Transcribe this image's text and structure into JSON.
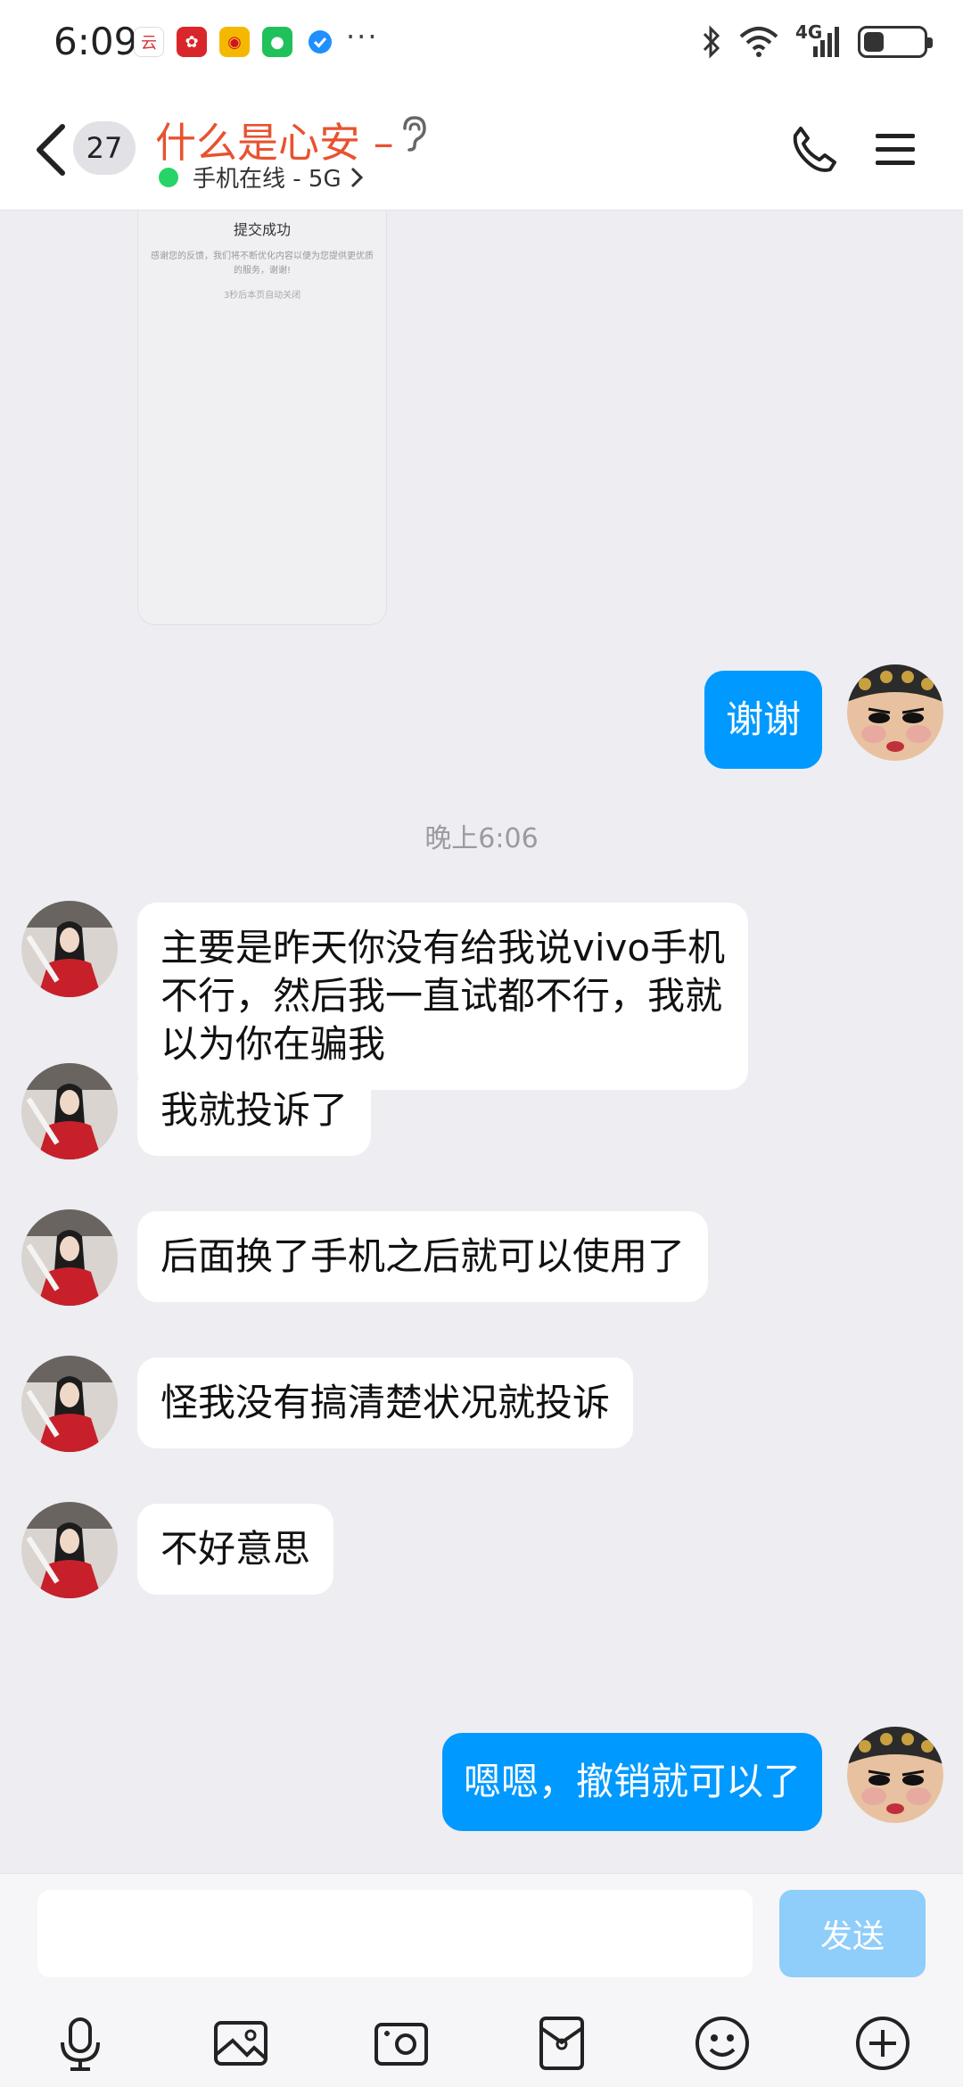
{
  "status_bar": {
    "time": "6:09",
    "more": "···",
    "network": "4G"
  },
  "header": {
    "unread_count": "27",
    "title": "什么是心安 –",
    "online_status": "手机在线 - 5G"
  },
  "messages": {
    "screenshot_card": {
      "title": "提交成功",
      "description": "感谢您的反馈，我们将不断优化内容以便为您提供更优质的服务，谢谢!",
      "note": "3秒后本页自动关闭"
    },
    "m1": {
      "text": "谢谢"
    },
    "timestamp": "晚上6:06",
    "m2": {
      "line1": "主要是昨天你没有给我说vivo手机",
      "line2": "不行，然后我一直试都不行，我就",
      "line3": "以为你在骗我"
    },
    "m3": {
      "text": "我就投诉了"
    },
    "m4": {
      "text": "后面换了手机之后就可以使用了"
    },
    "m5": {
      "text": "怪我没有搞清楚状况就投诉"
    },
    "m6": {
      "text": "不好意思"
    },
    "m7": {
      "text": "嗯嗯，撤销就可以了"
    }
  },
  "input_bar": {
    "input_value": "",
    "send_label": "发送"
  },
  "toolbar": [
    "microphone-icon",
    "image-icon",
    "camera-icon",
    "red-packet-icon",
    "emoji-icon",
    "plus-icon"
  ],
  "colors": {
    "accent": "#0099ff",
    "title": "#e8522f",
    "online": "#26d467",
    "background": "#ededf2"
  }
}
